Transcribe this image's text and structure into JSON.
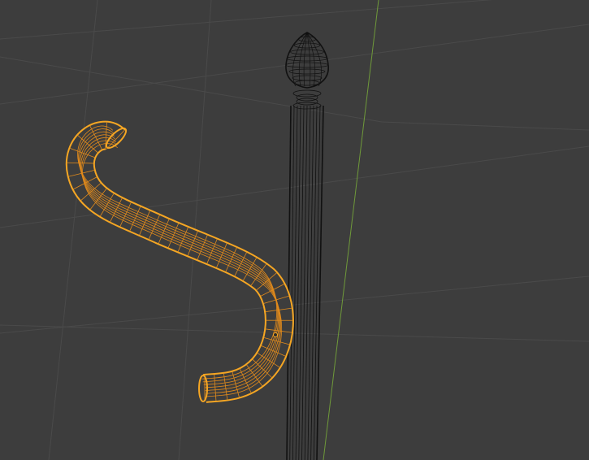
{
  "viewport": {
    "background_color": "#3d3d3d",
    "grid_color": "#4a4a4a",
    "y_axis_color": "#6f9a3a"
  },
  "objects": [
    {
      "name": "hook",
      "selected": true,
      "display": "wireframe",
      "outline_color": "#f5a623",
      "wire_color": "#e08a1c",
      "origin_color": "#2a2a2a"
    },
    {
      "name": "pole",
      "selected": false,
      "display": "wireframe",
      "wire_color": "#111111"
    }
  ]
}
